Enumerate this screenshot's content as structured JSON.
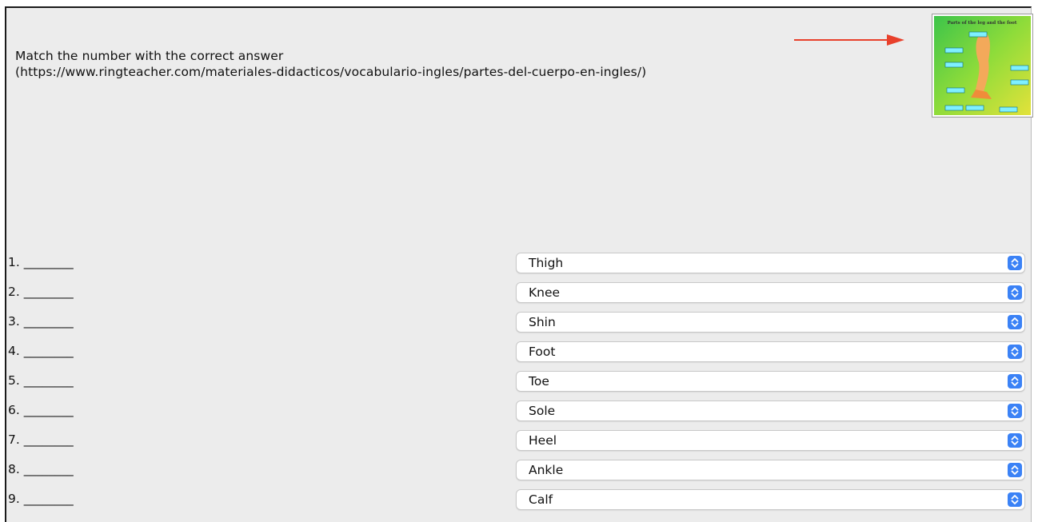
{
  "instructions": {
    "line1": "Match the number with the correct answer",
    "line2": "(https://www.ringteacher.com/materiales-didacticos/vocabulario-ingles/partes-del-cuerpo-en-ingles/)"
  },
  "thumbnail": {
    "title": "Parts of the leg and the foot",
    "icon": "leg-diagram-image"
  },
  "arrow": {
    "color": "#e8402b",
    "icon": "arrow-right-icon"
  },
  "items": [
    {
      "label": "1. ________",
      "selected": "Thigh"
    },
    {
      "label": "2. ________",
      "selected": "Knee"
    },
    {
      "label": "3. ________",
      "selected": "Shin"
    },
    {
      "label": "4. ________",
      "selected": "Foot"
    },
    {
      "label": "5. ________",
      "selected": "Toe"
    },
    {
      "label": "6. ________",
      "selected": "Sole"
    },
    {
      "label": "7. ________",
      "selected": "Heel"
    },
    {
      "label": "8. ________",
      "selected": "Ankle"
    },
    {
      "label": "9. ________",
      "selected": "Calf"
    }
  ],
  "colors": {
    "select_accent": "#3b82f6",
    "background": "#ececec"
  }
}
